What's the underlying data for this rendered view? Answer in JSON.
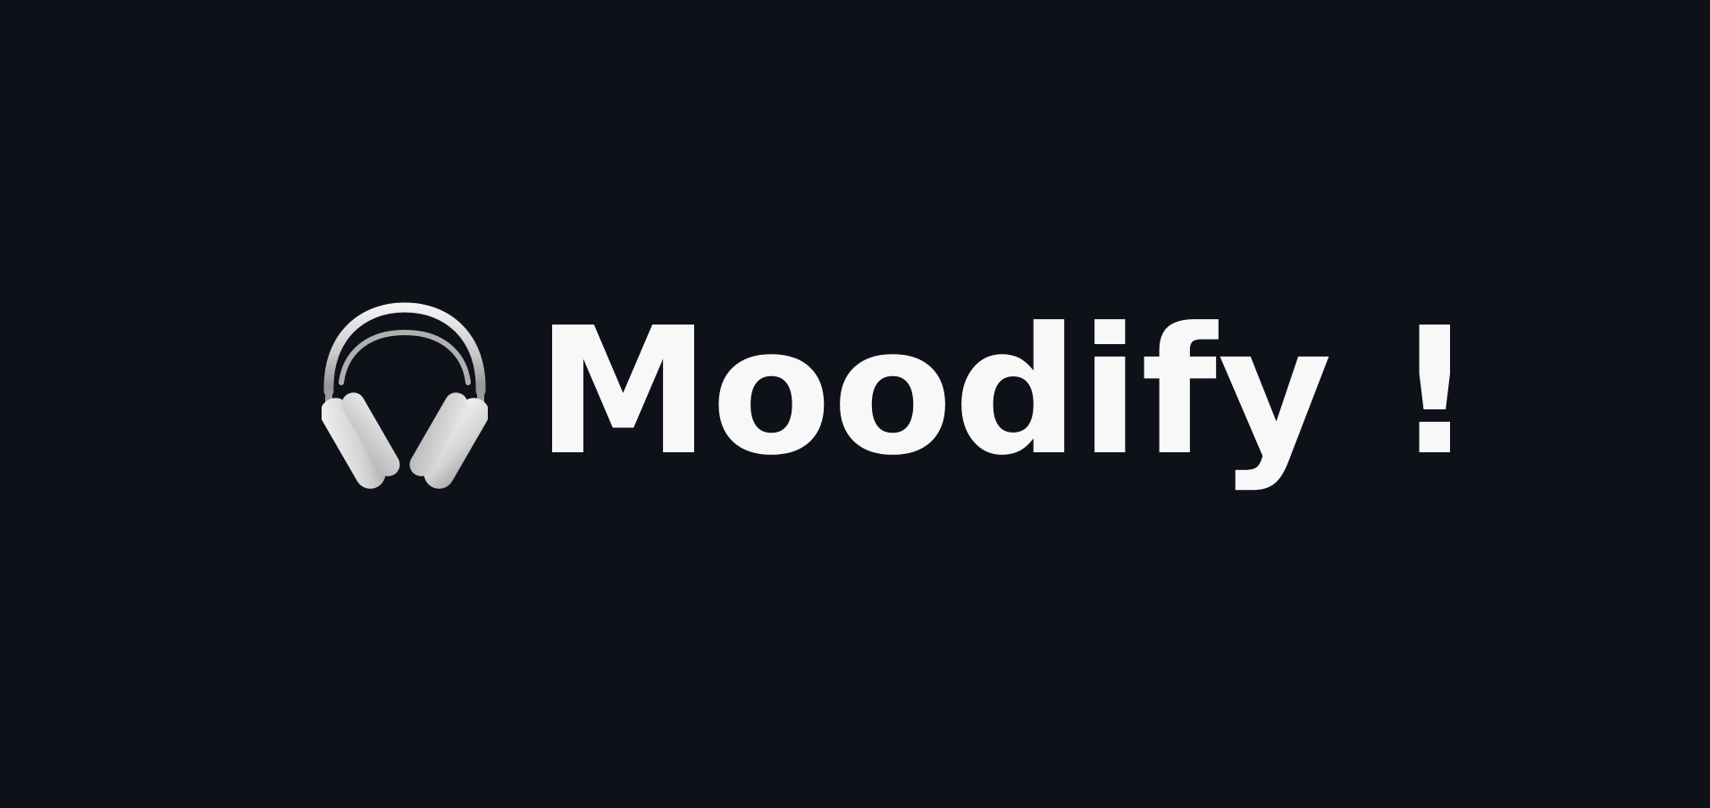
{
  "app": {
    "title": "Moodify !",
    "icon": "headphones-icon",
    "background_color": "#0e1118",
    "text_color": "#f8f8f8"
  }
}
